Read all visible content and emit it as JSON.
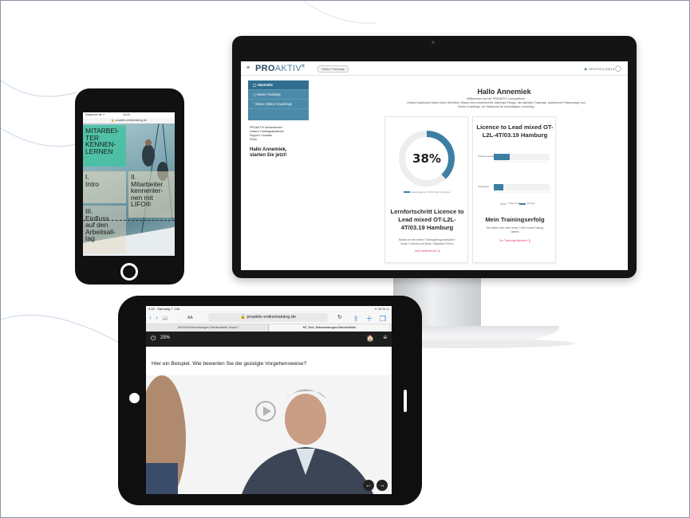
{
  "monitor": {
    "menu_icon": "hamburger-icon",
    "logo_bold": "PRO",
    "logo_thin": "AKTIV",
    "logo_mark": "®",
    "badge": "Online Trainings",
    "user_label": "DEUTSCH (DE) ▾",
    "user_icon": "user-icon",
    "sidebar": [
      {
        "icon": "home-icon",
        "label": "Startseite"
      },
      {
        "icon": "calendar-icon",
        "label": "Meine Trainings"
      },
      {
        "icon": "group-icon",
        "label": "Meine Online Coachings"
      }
    ],
    "side_links": [
      "PROAKTIV kennenlernen",
      "Unsere Trainingsakademie",
      "Support / Kontakt",
      "FAQs"
    ],
    "hello_side_line1": "Hallo Annemiek,",
    "hello_side_line2": "starten Sie jetzt!",
    "title": "Hallo Annemiek",
    "sub_line1": "Willkommen auf der PROAKTIV Lernplattform.",
    "sub_line2": "Dieses Dashboard bietet Ihnen Überblick: Status und Lernfortschritt, bisherige Erfolge, die nächsten Trainings, anstehende Präsenztage und",
    "sub_line3": "Online Coachings. Ihr Startpunkt für nachhaltigen Lernerfolg.",
    "card1": {
      "percent_label": "38%",
      "legend_done": "bereits gelernt",
      "legend_open": "noch zu lernen",
      "title": "Lernfortschritt Licence to Lead mixed OT-L2L-4T/03.19 Hamburg",
      "text_line1": "Nahtlos an den letzten Trainingserfolg anknüpfen?",
      "text_line2": "Modul 4 Zuhören mit Zielen / Situatives Führen",
      "link": "Jetzt weiterlernen ❯"
    },
    "card2": {
      "title": "Licence to Lead mixed OT-L2L-4T/03.19 Hamburg",
      "row1_label": "Präsenzmodule",
      "row2_label": "Coachings",
      "legend1": "Präsenztag",
      "legend2": "Erfolge",
      "h2": "Mein Trainingserfolg",
      "text_line1": "Sie wollen noch mehr lernen? Hier! neues Training",
      "text_line2": "starten!",
      "link": "Zur Trainingsübersicht ❯"
    }
  },
  "chart_data": {
    "type": "pie",
    "categories": [
      "bereits gelernt",
      "noch zu lernen"
    ],
    "values": [
      38,
      62
    ],
    "title": "38%"
  },
  "phone": {
    "status_left": "Swisscom de ᯤ",
    "status_time": "16:15",
    "url": "🔒 proaktiv-onlinetraining.de",
    "tile1": [
      "MITARBEI-",
      "TER",
      "KENNEN-",
      "LERNEN"
    ],
    "tile2": [
      "I.",
      "Intro"
    ],
    "tile3": [
      "II.",
      "Mitarbeiter",
      "kennenler-",
      "nen mit",
      "LIFO®"
    ],
    "tile4": [
      "III.",
      "Einfluss",
      "auf den",
      "Arbeitsall-",
      "tag"
    ]
  },
  "tablet": {
    "status_left": "9:29 · Samstag 7. Okt.",
    "status_right": "ᯤ 43 % ▭",
    "nav_back": "‹",
    "nav_forward": "›",
    "book_icon": "📖",
    "aa": "AA",
    "url": "🔒 proaktiv-onlinetraining.de",
    "reload_icon": "↻",
    "actions": "⇪ ＋ ❐",
    "tab1": "M3.ENA Entscheidungen Übersichtseite: Modul 7",
    "tab2": "M7_EnA_Entscheidungen-Übersichtsite",
    "power_icon": "⏻",
    "percent": "25%",
    "home_icon": "🏠",
    "menu_icon": "≡",
    "question": "Hier ein Beispiel. Wie bewerten Sie die gezeigte Vorgehensweise?",
    "prev": "←",
    "next": "→"
  }
}
